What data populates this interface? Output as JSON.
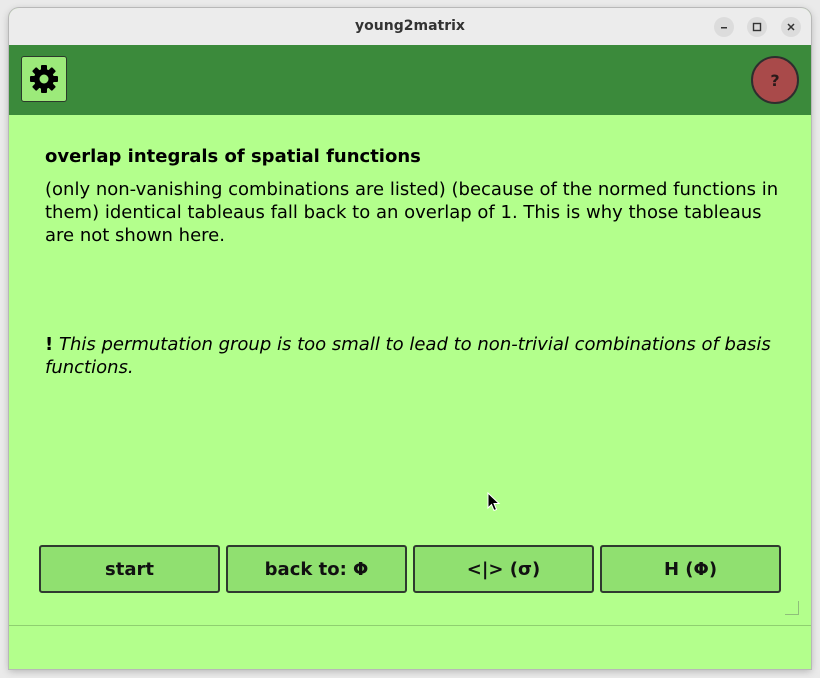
{
  "window": {
    "title": "young2matrix"
  },
  "toolbar": {
    "help_label": "?"
  },
  "content": {
    "heading": "overlap integrals of spatial functions",
    "description": "(only non-vanishing combinations are listed) (because of the normed functions in them) identical tableaus fall back to an overlap of 1. This is why those tableaus are not shown here.",
    "warning_mark": "!",
    "warning_text": "This permutation group is too small to lead to non-trivial combinations of basis functions."
  },
  "nav": {
    "start": "start",
    "back": "back to: Φ",
    "overlap": "<|> (σ)",
    "hamiltonian": "H (Φ)"
  },
  "colors": {
    "background": "#b3ff8c",
    "toolbar": "#3b8a3b",
    "button": "#90e070",
    "help": "#a94a4a"
  },
  "icons": [
    "gear-icon",
    "help-icon",
    "minimize-icon",
    "maximize-icon",
    "close-icon",
    "mouse-cursor-icon"
  ]
}
